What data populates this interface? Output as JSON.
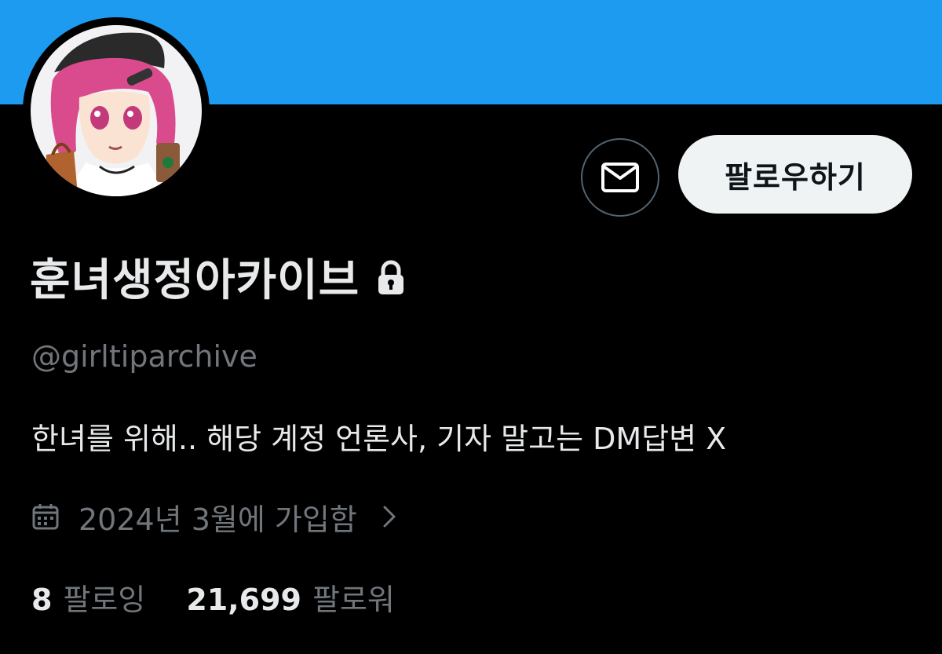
{
  "colors": {
    "banner": "#1d9bf0",
    "background": "#000000",
    "primary_text": "#e7e9ea",
    "secondary_text": "#71767b",
    "follow_button_bg": "#eff3f4",
    "follow_button_text": "#0f1419"
  },
  "header": {
    "avatar_icon": "profile-avatar",
    "dm_icon": "envelope-icon",
    "follow_label": "팔로우하기"
  },
  "profile": {
    "display_name": "훈녀생정아카이브",
    "protected_icon": "lock-icon",
    "handle": "@girltiparchive",
    "bio": "한녀를 위해.. 해당 계정 언론사, 기자 말고는 DM답변 X",
    "joined": {
      "icon": "calendar-icon",
      "text": "2024년 3월에 가입함",
      "chevron_icon": "chevron-right-icon"
    },
    "stats": {
      "following_count": "8",
      "following_label": "팔로잉",
      "followers_count": "21,699",
      "followers_label": "팔로워"
    }
  }
}
